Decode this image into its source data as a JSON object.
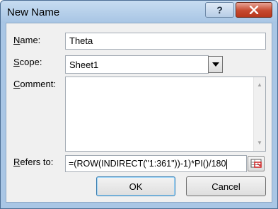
{
  "window": {
    "title": "New Name",
    "help_icon": "question-mark-icon",
    "close_icon": "close-x-icon"
  },
  "form": {
    "name_label_accel": "N",
    "name_label_rest": "ame:",
    "name_value": "Theta",
    "scope_label_accel": "S",
    "scope_label_rest": "cope:",
    "scope_value": "Sheet1",
    "comment_label_accel": "C",
    "comment_label_rest": "omment:",
    "comment_value": "",
    "refers_label_accel": "R",
    "refers_label_rest": "efers to:",
    "refers_value": "=(ROW(INDIRECT(\"1:361\"))-1)*PI()/180"
  },
  "buttons": {
    "ok": "OK",
    "cancel": "Cancel"
  }
}
